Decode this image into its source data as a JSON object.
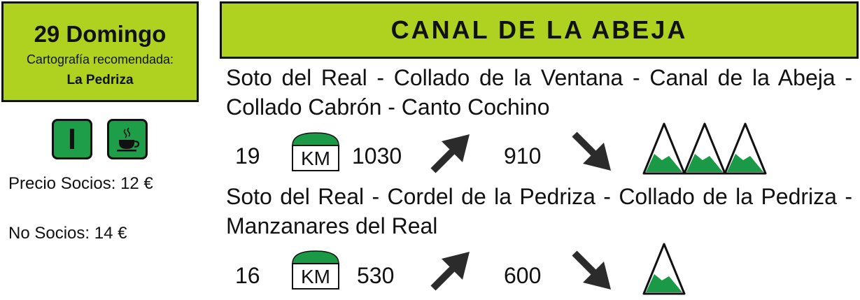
{
  "sidebar": {
    "date": "29 Domingo",
    "cartography_label": "Cartografía recomendada:",
    "cartography_map": "La Pedriza",
    "level_badge": "I",
    "level_icon": "roman-numeral-one-icon",
    "service_icon": "coffee-cup-icon",
    "price_members": "Precio Socios: 12 €",
    "price_non_members": "No Socios: 14 €"
  },
  "header": {
    "title": "CANAL DE LA ABEJA"
  },
  "routes": [
    {
      "name": "Soto del Real - Collado de la Ventana - Canal de la Abeja - Collado Cabrón - Canto Cochino",
      "distance": "19",
      "km_label": "KM",
      "ascent": "1030",
      "descent": "910",
      "difficulty": 3
    },
    {
      "name": "Soto del Real - Cordel de la Pedriza - Collado de la Pedriza - Manzanares del Real",
      "distance": "16",
      "km_label": "KM",
      "ascent": "530",
      "descent": "600",
      "difficulty": 1
    }
  ],
  "colors": {
    "accent_lime": "#aed21f",
    "badge_green": "#1e9e48",
    "mountain_green": "#1a9a46",
    "arrow_dark": "#2b2b2b"
  }
}
